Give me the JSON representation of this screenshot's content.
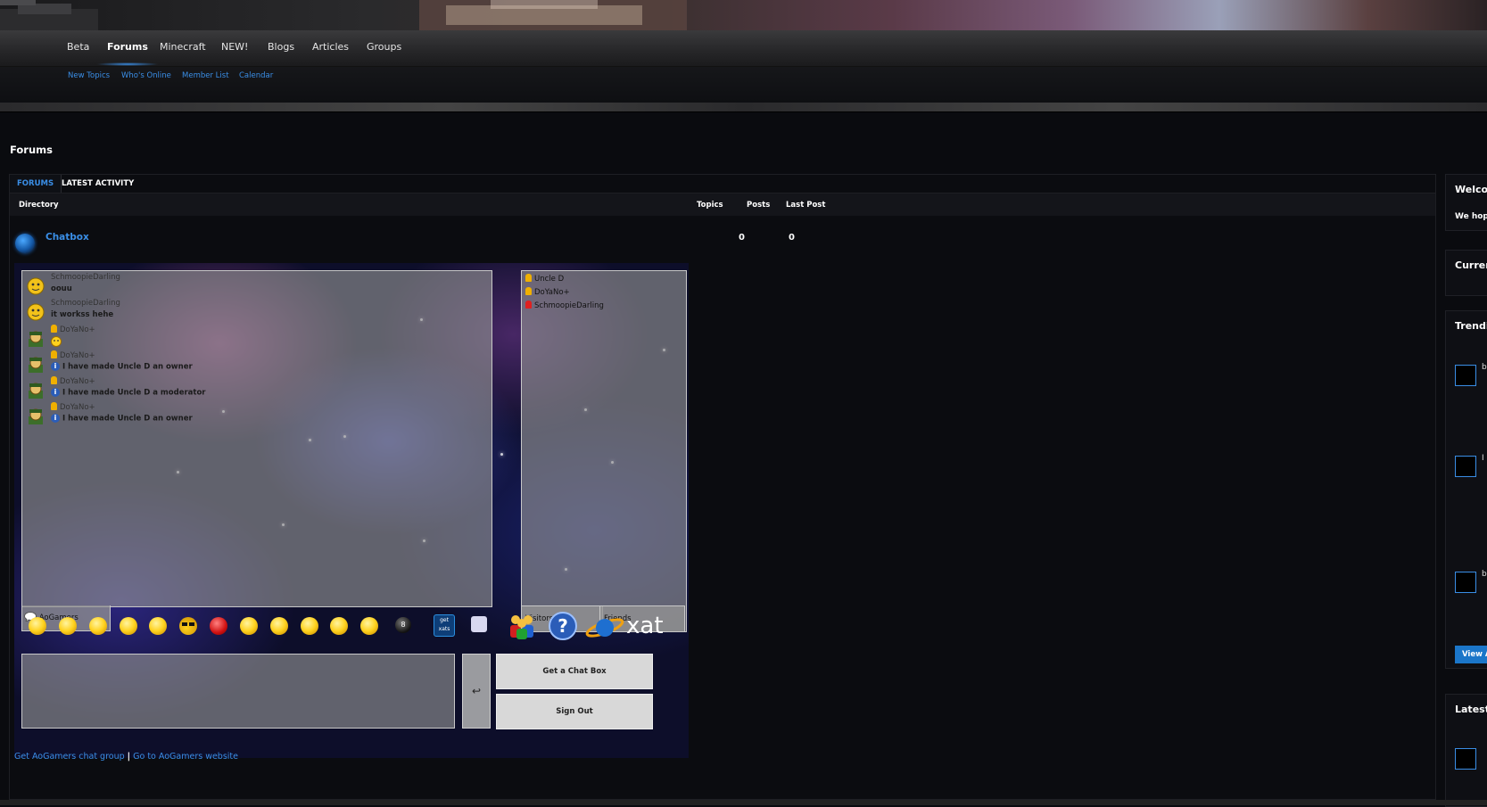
{
  "nav": {
    "items": [
      "Beta",
      "Forums",
      "Minecraft",
      "NEW!",
      "Blogs",
      "Articles",
      "Groups"
    ],
    "active": "Forums"
  },
  "subnav": {
    "items": [
      "New Topics",
      "Who's Online",
      "Member List",
      "Calendar"
    ]
  },
  "page": {
    "title": "Forums"
  },
  "tabs": {
    "forums": "FORUMS",
    "latest": "LATEST ACTIVITY"
  },
  "columns": {
    "directory": "Directory",
    "topics": "Topics",
    "posts": "Posts",
    "last_post": "Last Post"
  },
  "forum_row": {
    "name": "Chatbox",
    "topics": "0",
    "posts": "0"
  },
  "chat": {
    "messages": [
      {
        "user": "SchmoopieDarling",
        "text": "oouu",
        "avatar": "yellow-smiley-avatar"
      },
      {
        "user": "SchmoopieDarling",
        "text": "it workss hehe",
        "avatar": "yellow-smiley-avatar"
      },
      {
        "user": "DoYaNo+",
        "text": "",
        "avatar": "green-soldier-avatar"
      },
      {
        "user": "DoYaNo+",
        "text": "I have made Uncle D an owner",
        "avatar": "green-soldier-avatar"
      },
      {
        "user": "DoYaNo+",
        "text": "I have made Uncle D a moderator",
        "avatar": "green-soldier-avatar"
      },
      {
        "user": "DoYaNo+",
        "text": "I have made Uncle D an owner",
        "avatar": "green-soldier-avatar"
      }
    ],
    "room_tab": "AoGamers",
    "users": [
      {
        "name": "Uncle D",
        "rank_color": "#f0b000"
      },
      {
        "name": "DoYaNo+",
        "rank_color": "#f0b000"
      },
      {
        "name": "SchmoopieDarling",
        "rank_color": "#e02020"
      }
    ],
    "user_tabs": {
      "visitors": "Visitors",
      "friends": "Friends"
    },
    "get_chat_box": "Get a Chat Box",
    "sign_out": "Sign Out",
    "enter_symbol": "↩",
    "brand": "xat",
    "get_xats": "get xats",
    "links": {
      "group": "Get AoGamers chat group",
      "sep": "|",
      "website": "Go to AoGamers website"
    }
  },
  "sidebar": {
    "welcome_title": "Welcome",
    "welcome_text": "We hope",
    "current_title": "Current",
    "trending_title": "Trending",
    "view_all": "View All",
    "latest_title": "Latest"
  },
  "colors": {
    "accent": "#3a8ee6",
    "button_blue": "#1b76c9"
  }
}
